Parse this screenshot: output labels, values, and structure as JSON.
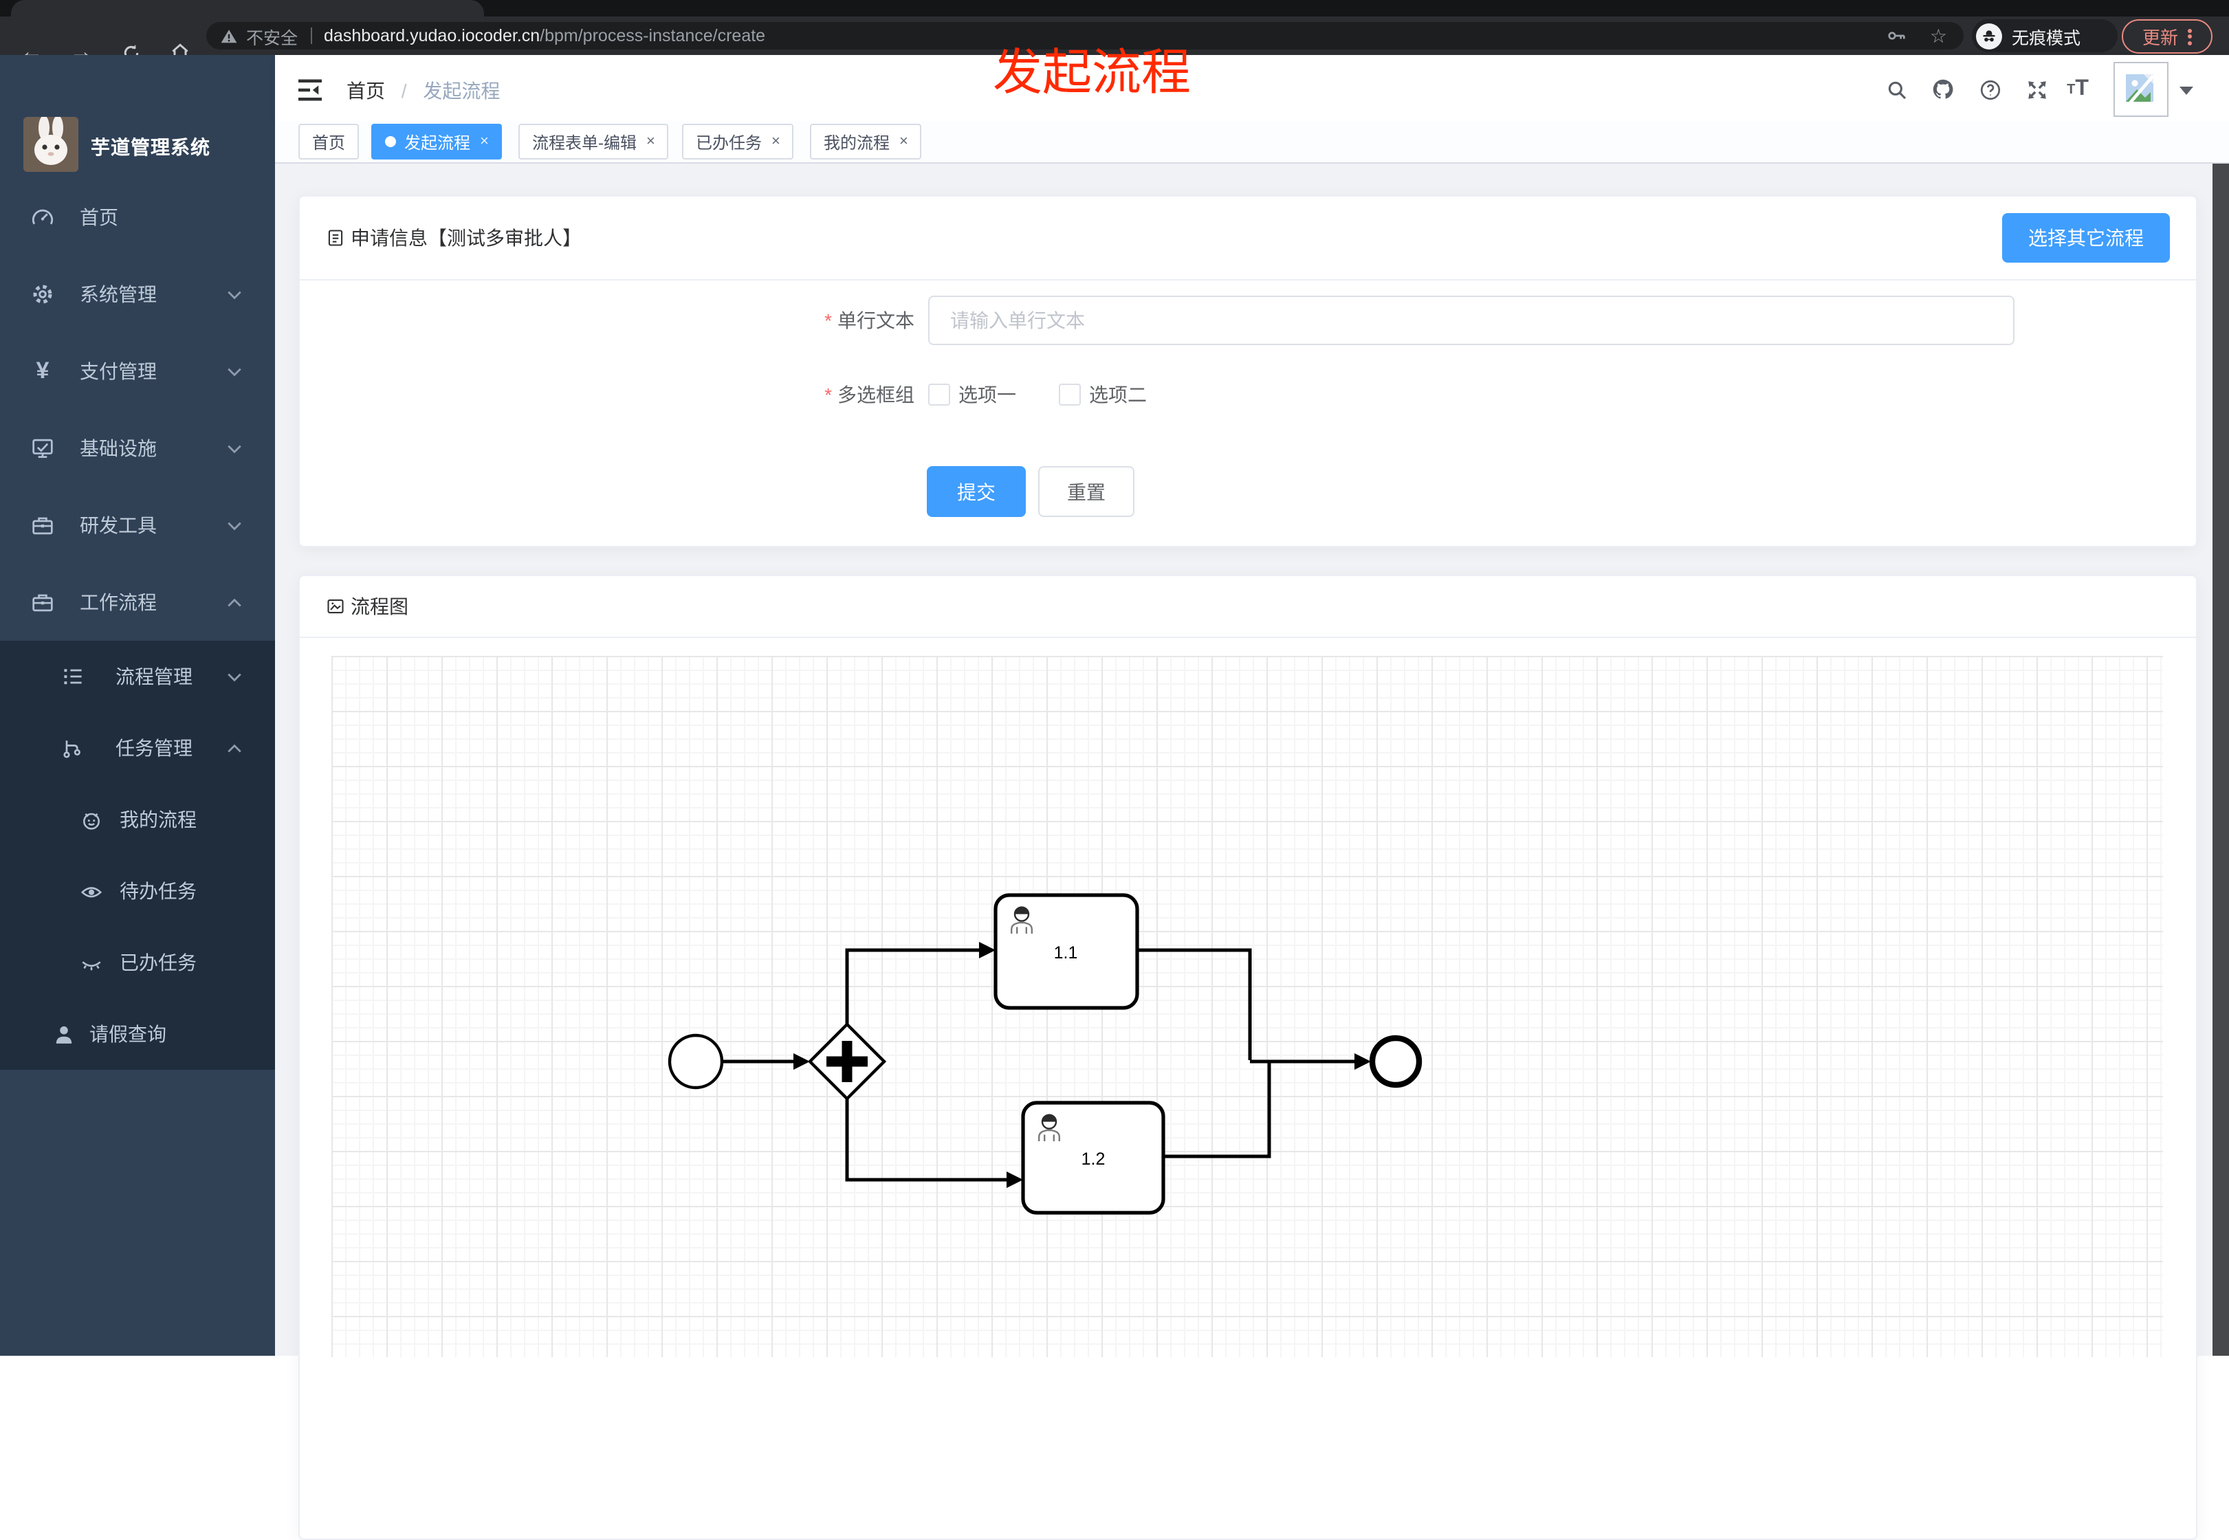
{
  "browser": {
    "security_label": "不安全",
    "url_domain": "dashboard.yudao.iocoder.cn",
    "url_path": "/bpm/process-instance/create",
    "incognito_label": "无痕模式",
    "update_label": "更新"
  },
  "annotation": {
    "text": "发起流程",
    "color": "#ff2a00"
  },
  "sidebar": {
    "title": "芋道管理系统",
    "menu": [
      {
        "label": "首页"
      },
      {
        "label": "系统管理"
      },
      {
        "label": "支付管理"
      },
      {
        "label": "基础设施"
      },
      {
        "label": "研发工具"
      },
      {
        "label": "工作流程"
      }
    ],
    "submenu": [
      {
        "label": "流程管理"
      },
      {
        "label": "任务管理"
      }
    ],
    "task_children": [
      {
        "label": "我的流程"
      },
      {
        "label": "待办任务"
      },
      {
        "label": "已办任务"
      }
    ],
    "leave_item": {
      "label": "请假查询"
    }
  },
  "header": {
    "breadcrumb_home": "首页",
    "breadcrumb_sep": "/",
    "breadcrumb_current": "发起流程"
  },
  "tabs": {
    "close_glyph": "×",
    "items": [
      {
        "label": "首页",
        "active": false,
        "closable": false
      },
      {
        "label": "发起流程",
        "active": true,
        "closable": true
      },
      {
        "label": "流程表单-编辑",
        "active": false,
        "closable": true
      },
      {
        "label": "已办任务",
        "active": false,
        "closable": true
      },
      {
        "label": "我的流程",
        "active": false,
        "closable": true
      }
    ]
  },
  "form_card": {
    "title": "申请信息【测试多审批人】",
    "choose_button": "选择其它流程",
    "fields": [
      {
        "label": "单行文本",
        "required": true,
        "value": "",
        "placeholder": "请输入单行文本"
      },
      {
        "label": "多选框组",
        "required": true,
        "options": [
          "选项一",
          "选项二"
        ],
        "checked": [
          false,
          false
        ]
      }
    ],
    "submit_label": "提交",
    "reset_label": "重置"
  },
  "flow_card": {
    "title": "流程图",
    "nodes": [
      {
        "type": "start-event",
        "label": ""
      },
      {
        "type": "parallel-gateway",
        "label": ""
      },
      {
        "type": "user-task",
        "label": "1.1"
      },
      {
        "type": "user-task",
        "label": "1.2"
      },
      {
        "type": "end-event",
        "label": ""
      }
    ]
  },
  "colors": {
    "primary": "#409eff",
    "sidebar_bg": "#304156",
    "submenu_bg": "#1f2d3d",
    "update_accent": "#e98a80"
  }
}
